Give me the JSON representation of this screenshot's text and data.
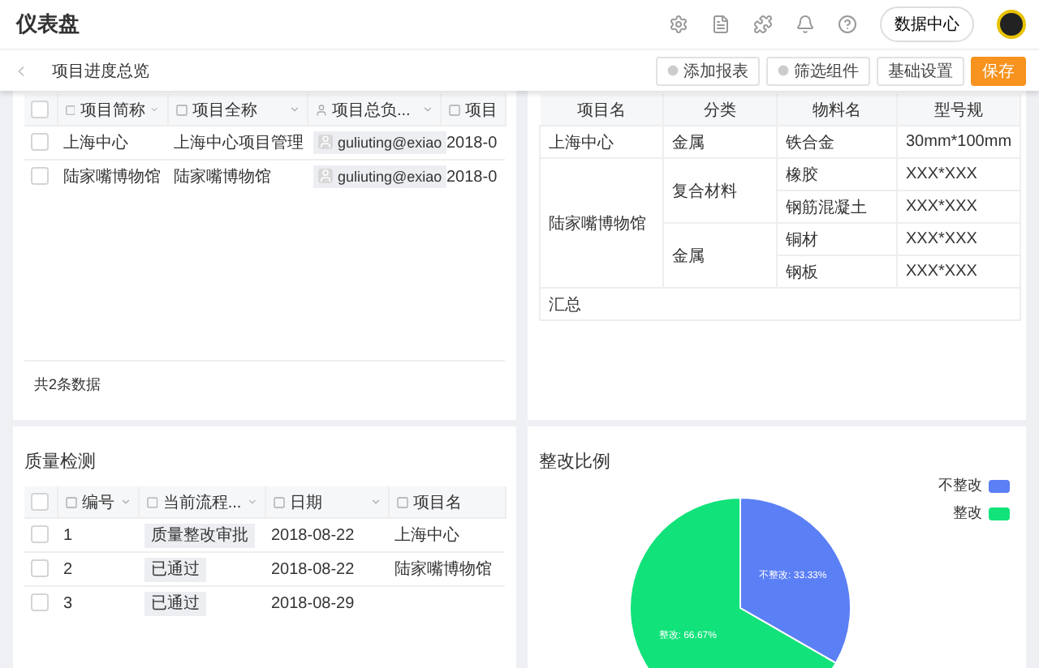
{
  "header": {
    "title": "仪表盘",
    "data_center_button": "数据中心"
  },
  "subheader": {
    "title": "项目进度总览",
    "buttons": [
      {
        "label": "添加报表",
        "kind": "icon"
      },
      {
        "label": "筛选组件",
        "kind": "icon"
      },
      {
        "label": "基础设置",
        "kind": "plain"
      },
      {
        "label": "保存",
        "kind": "primary"
      }
    ]
  },
  "projects_table": {
    "all_checked": false,
    "columns": [
      "项目简称",
      "项目全称",
      "项目总负...",
      "项目"
    ],
    "rows": [
      {
        "checked": false,
        "short_name": "上海中心",
        "full_name": "上海中心项目管理",
        "owner": "guliuting@exiao",
        "date": "2018-0"
      },
      {
        "checked": false,
        "short_name": "陆家嘴博物馆",
        "full_name": "陆家嘴博物馆",
        "owner": "guliuting@exiao",
        "date": "2018-0"
      }
    ],
    "footer": "共2条数据"
  },
  "materials_table": {
    "columns": [
      "项目名",
      "分类",
      "物料名",
      "型号规"
    ],
    "groups": [
      {
        "project": "上海中心",
        "categories": [
          {
            "name": "金属",
            "items": [
              {
                "material": "铁合金",
                "spec": "30mm*100mm"
              }
            ]
          }
        ]
      },
      {
        "project": "陆家嘴博物馆",
        "categories": [
          {
            "name": "复合材料",
            "items": [
              {
                "material": "橡胶",
                "spec": "XXX*XXX"
              },
              {
                "material": "钢筋混凝土",
                "spec": "XXX*XXX"
              }
            ]
          },
          {
            "name": "金属",
            "items": [
              {
                "material": "铜材",
                "spec": "XXX*XXX"
              },
              {
                "material": "钢板",
                "spec": "XXX*XXX"
              }
            ]
          }
        ]
      }
    ],
    "summary": "汇总"
  },
  "quality_card": {
    "title": "质量检测",
    "all_checked": false,
    "columns": [
      "编号",
      "当前流程...",
      "日期",
      "项目名"
    ],
    "rows": [
      {
        "checked": false,
        "number": "1",
        "status": "质量整改审批",
        "date": "2018-08-22",
        "project": "上海中心"
      },
      {
        "checked": false,
        "number": "2",
        "status": "已通过",
        "date": "2018-08-22",
        "project": "陆家嘴博物馆"
      },
      {
        "checked": false,
        "number": "3",
        "status": "已通过",
        "date": "2018-08-29",
        "project": ""
      }
    ]
  },
  "ratio_card": {
    "title": "整改比例",
    "chart_data": {
      "type": "pie",
      "categories": [
        "不整改",
        "整改"
      ],
      "values": [
        33.33,
        66.67
      ],
      "colors": [
        "#5b7ff5",
        "#12e27a"
      ],
      "value_labels": [
        "不整改: 33.33%",
        "整改: 66.67%"
      ]
    }
  }
}
